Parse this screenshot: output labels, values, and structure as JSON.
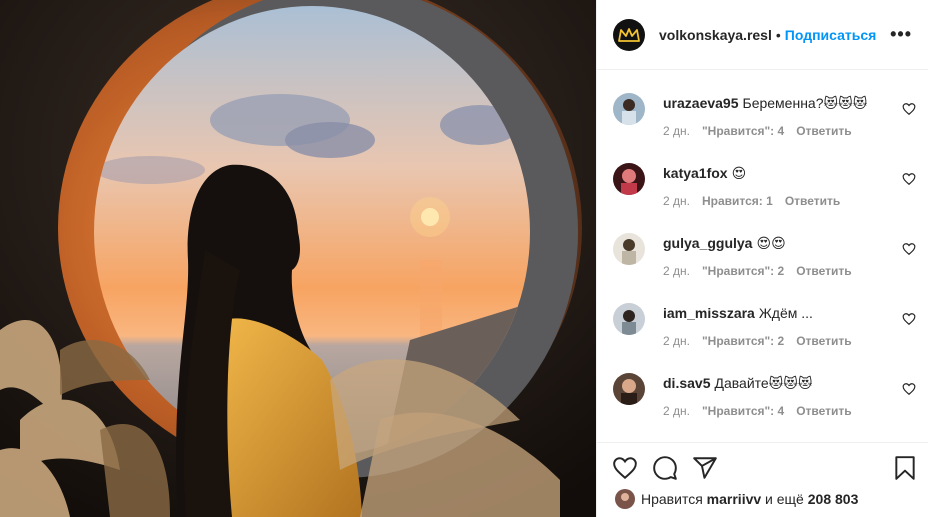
{
  "post": {
    "owner": "volkonskaya.resl",
    "separator": "•",
    "follow_label": "Подписаться",
    "more_label": "•••"
  },
  "comments": [
    {
      "user": "urazaeva95",
      "text": "Беременна?😻😻😻",
      "time": "2 дн.",
      "likes": "\"Нравится\": 4",
      "reply": "Ответить"
    },
    {
      "user": "katya1fox",
      "text": "😍",
      "time": "2 дн.",
      "likes": "Нравится: 1",
      "reply": "Ответить"
    },
    {
      "user": "gulya_ggulya",
      "text": "😍😍",
      "time": "2 дн.",
      "likes": "\"Нравится\": 2",
      "reply": "Ответить"
    },
    {
      "user": "iam_misszara",
      "text": "Ждём ...",
      "time": "2 дн.",
      "likes": "\"Нравится\": 2",
      "reply": "Ответить"
    },
    {
      "user": "di.sav5",
      "text": "Давайте😻😻😻",
      "time": "2 дн.",
      "likes": "\"Нравится\": 4",
      "reply": "Ответить"
    }
  ],
  "likes_bar": {
    "prefix": "Нравится",
    "user": "marriivv",
    "connector": "и ещё",
    "count": "208 803"
  },
  "colors": {
    "accent": "#0095f6",
    "text": "#262626",
    "muted": "#8e8e8e",
    "border": "#efefef"
  },
  "icons": [
    "crown-logo-icon",
    "more-options-icon",
    "heart-icon",
    "comment-icon",
    "share-icon",
    "bookmark-icon"
  ]
}
